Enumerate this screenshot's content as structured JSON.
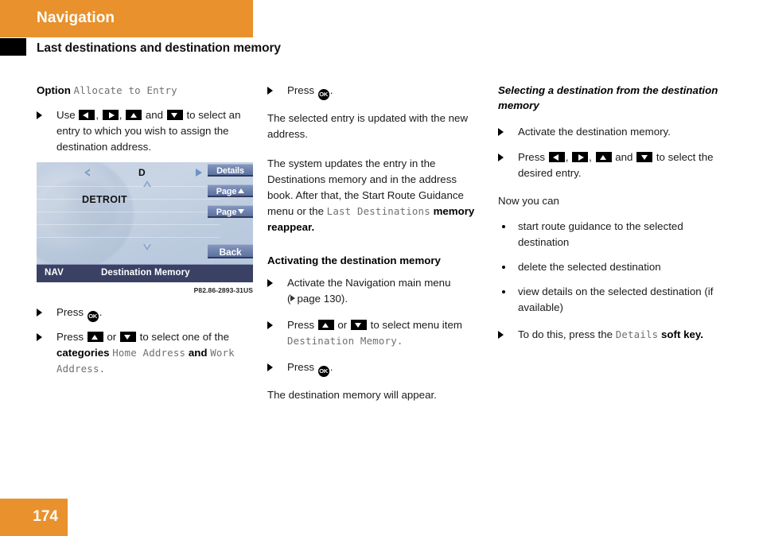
{
  "header": {
    "chapter": "Navigation",
    "section": "Last destinations and destination memory",
    "accent_color": "#e8912d"
  },
  "footer": {
    "page_number": "174"
  },
  "column1": {
    "option_label": "Option",
    "option_value": "Allocate to Entry",
    "step_use_pre": "Use",
    "step_use_mid": ",",
    "step_use_and": "and",
    "step_use_post": "to select an entry to which you wish to assign the destination address.",
    "press_ok": "Press",
    "press_ok_period": ".",
    "press_updown_pre": "Press",
    "press_updown_or": "or",
    "press_updown_post": "to select one of the",
    "categories_word": "categories",
    "category_1": "Home Address",
    "categories_and": "and",
    "category_2": "Work Address",
    "categories_period": "."
  },
  "figure": {
    "caption": "P82.86-2893-31US",
    "letter": "D",
    "city": "DETROIT",
    "softkeys": [
      {
        "label": "Details",
        "arrow": "none"
      },
      {
        "label": "Page",
        "arrow": "up"
      },
      {
        "label": "Page",
        "arrow": "down"
      },
      {
        "label": "Back",
        "arrow": "none"
      }
    ],
    "status_left": "NAV",
    "status_title": "Destination Memory"
  },
  "column2": {
    "press_ok": "Press",
    "press_ok_period": ".",
    "para_1": "The selected entry is updated with the new address.",
    "para_2_a": "The system updates the entry in the Destinations memory and in the address book. After that, the Start Route Guidance menu or the ",
    "para_2_mono": "Last Destinations",
    "para_2_b": " memory reappear.",
    "heading": "Activating the destination memory",
    "step_activate": "Activate the Navigation main menu",
    "page_ref": "page 130).",
    "page_ref_open": "(",
    "press_updown_pre": "Press",
    "press_updown_or": "or",
    "press_updown_post": "to select menu item",
    "menu_item": "Destination Memory",
    "menu_item_period": ".",
    "para_3": "The destination memory will appear."
  },
  "column3": {
    "heading": "Selecting a destination from the destination memory",
    "step_activate": "Activate the destination memory.",
    "press_pre": "Press",
    "press_comma": ",",
    "press_and": "and",
    "press_post": "to select the desired entry.",
    "now_you_can": "Now you can",
    "bullets": [
      "start route guidance to the selected destination",
      "delete the selected destination",
      "view details on the selected destination (if available)"
    ],
    "todo_pre": "To do this, press the",
    "todo_mono": "Details",
    "todo_post": "soft key."
  }
}
